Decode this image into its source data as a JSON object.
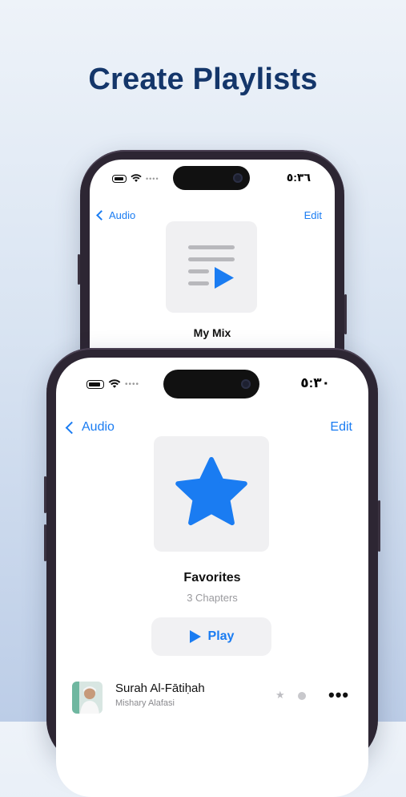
{
  "headline": "Create Playlists",
  "back_phone": {
    "time": "٥:٣٦",
    "nav_back": "Audio",
    "nav_edit": "Edit",
    "playlist_title": "My Mix",
    "art_icon": "playlist-play-icon"
  },
  "front_phone": {
    "time": "٥:٣٠",
    "nav_back": "Audio",
    "nav_edit": "Edit",
    "playlist_title": "Favorites",
    "playlist_subtitle": "3 Chapters",
    "art_icon": "star-icon",
    "play_label": "Play",
    "tracks": [
      {
        "title": "Surah Al-Fātiḥah",
        "artist": "Mishary Alafasi"
      }
    ]
  },
  "colors": {
    "accent": "#1a7cf2",
    "headline": "#14366a"
  }
}
